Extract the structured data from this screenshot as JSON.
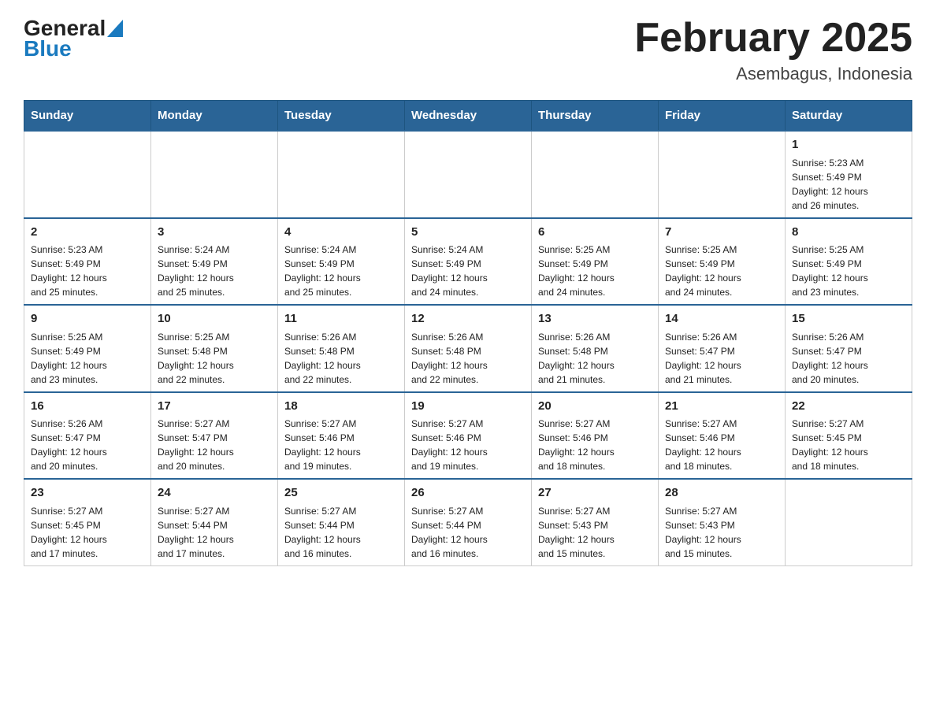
{
  "header": {
    "logo_general": "General",
    "logo_blue": "Blue",
    "month_title": "February 2025",
    "location": "Asembagus, Indonesia"
  },
  "weekdays": [
    "Sunday",
    "Monday",
    "Tuesday",
    "Wednesday",
    "Thursday",
    "Friday",
    "Saturday"
  ],
  "weeks": [
    {
      "days": [
        {
          "num": "",
          "info": ""
        },
        {
          "num": "",
          "info": ""
        },
        {
          "num": "",
          "info": ""
        },
        {
          "num": "",
          "info": ""
        },
        {
          "num": "",
          "info": ""
        },
        {
          "num": "",
          "info": ""
        },
        {
          "num": "1",
          "info": "Sunrise: 5:23 AM\nSunset: 5:49 PM\nDaylight: 12 hours\nand 26 minutes."
        }
      ]
    },
    {
      "days": [
        {
          "num": "2",
          "info": "Sunrise: 5:23 AM\nSunset: 5:49 PM\nDaylight: 12 hours\nand 25 minutes."
        },
        {
          "num": "3",
          "info": "Sunrise: 5:24 AM\nSunset: 5:49 PM\nDaylight: 12 hours\nand 25 minutes."
        },
        {
          "num": "4",
          "info": "Sunrise: 5:24 AM\nSunset: 5:49 PM\nDaylight: 12 hours\nand 25 minutes."
        },
        {
          "num": "5",
          "info": "Sunrise: 5:24 AM\nSunset: 5:49 PM\nDaylight: 12 hours\nand 24 minutes."
        },
        {
          "num": "6",
          "info": "Sunrise: 5:25 AM\nSunset: 5:49 PM\nDaylight: 12 hours\nand 24 minutes."
        },
        {
          "num": "7",
          "info": "Sunrise: 5:25 AM\nSunset: 5:49 PM\nDaylight: 12 hours\nand 24 minutes."
        },
        {
          "num": "8",
          "info": "Sunrise: 5:25 AM\nSunset: 5:49 PM\nDaylight: 12 hours\nand 23 minutes."
        }
      ]
    },
    {
      "days": [
        {
          "num": "9",
          "info": "Sunrise: 5:25 AM\nSunset: 5:49 PM\nDaylight: 12 hours\nand 23 minutes."
        },
        {
          "num": "10",
          "info": "Sunrise: 5:25 AM\nSunset: 5:48 PM\nDaylight: 12 hours\nand 22 minutes."
        },
        {
          "num": "11",
          "info": "Sunrise: 5:26 AM\nSunset: 5:48 PM\nDaylight: 12 hours\nand 22 minutes."
        },
        {
          "num": "12",
          "info": "Sunrise: 5:26 AM\nSunset: 5:48 PM\nDaylight: 12 hours\nand 22 minutes."
        },
        {
          "num": "13",
          "info": "Sunrise: 5:26 AM\nSunset: 5:48 PM\nDaylight: 12 hours\nand 21 minutes."
        },
        {
          "num": "14",
          "info": "Sunrise: 5:26 AM\nSunset: 5:47 PM\nDaylight: 12 hours\nand 21 minutes."
        },
        {
          "num": "15",
          "info": "Sunrise: 5:26 AM\nSunset: 5:47 PM\nDaylight: 12 hours\nand 20 minutes."
        }
      ]
    },
    {
      "days": [
        {
          "num": "16",
          "info": "Sunrise: 5:26 AM\nSunset: 5:47 PM\nDaylight: 12 hours\nand 20 minutes."
        },
        {
          "num": "17",
          "info": "Sunrise: 5:27 AM\nSunset: 5:47 PM\nDaylight: 12 hours\nand 20 minutes."
        },
        {
          "num": "18",
          "info": "Sunrise: 5:27 AM\nSunset: 5:46 PM\nDaylight: 12 hours\nand 19 minutes."
        },
        {
          "num": "19",
          "info": "Sunrise: 5:27 AM\nSunset: 5:46 PM\nDaylight: 12 hours\nand 19 minutes."
        },
        {
          "num": "20",
          "info": "Sunrise: 5:27 AM\nSunset: 5:46 PM\nDaylight: 12 hours\nand 18 minutes."
        },
        {
          "num": "21",
          "info": "Sunrise: 5:27 AM\nSunset: 5:46 PM\nDaylight: 12 hours\nand 18 minutes."
        },
        {
          "num": "22",
          "info": "Sunrise: 5:27 AM\nSunset: 5:45 PM\nDaylight: 12 hours\nand 18 minutes."
        }
      ]
    },
    {
      "days": [
        {
          "num": "23",
          "info": "Sunrise: 5:27 AM\nSunset: 5:45 PM\nDaylight: 12 hours\nand 17 minutes."
        },
        {
          "num": "24",
          "info": "Sunrise: 5:27 AM\nSunset: 5:44 PM\nDaylight: 12 hours\nand 17 minutes."
        },
        {
          "num": "25",
          "info": "Sunrise: 5:27 AM\nSunset: 5:44 PM\nDaylight: 12 hours\nand 16 minutes."
        },
        {
          "num": "26",
          "info": "Sunrise: 5:27 AM\nSunset: 5:44 PM\nDaylight: 12 hours\nand 16 minutes."
        },
        {
          "num": "27",
          "info": "Sunrise: 5:27 AM\nSunset: 5:43 PM\nDaylight: 12 hours\nand 15 minutes."
        },
        {
          "num": "28",
          "info": "Sunrise: 5:27 AM\nSunset: 5:43 PM\nDaylight: 12 hours\nand 15 minutes."
        },
        {
          "num": "",
          "info": ""
        }
      ]
    }
  ]
}
